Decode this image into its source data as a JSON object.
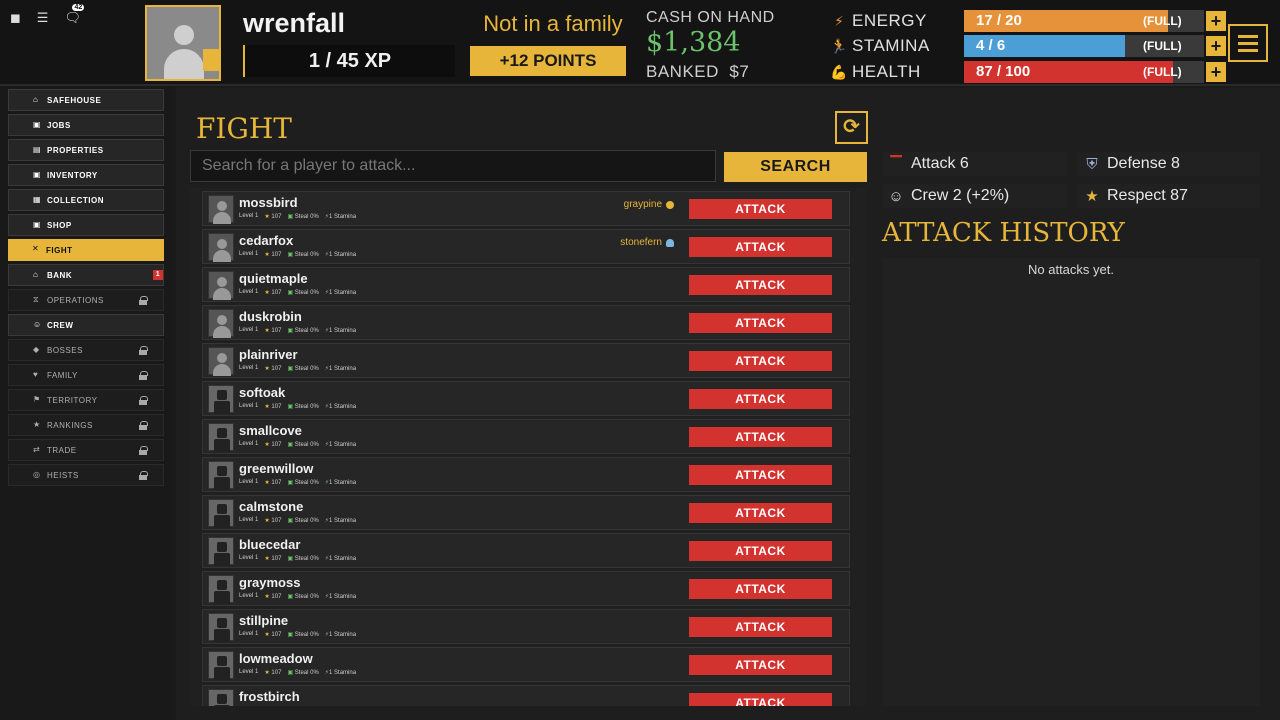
{
  "header": {
    "chat_badge": "42",
    "username": "wrenfall",
    "xp": "1 / 45 XP",
    "family_status": "Not in a family",
    "points_button": "+12 POINTS",
    "cash_label": "CASH ON HAND",
    "cash_value": "$1,384",
    "banked_label": "BANKED",
    "banked_value": "$7",
    "stats": [
      {
        "name": "ENERGY",
        "value": "17 / 20",
        "status": "(FULL)",
        "fill": 0.85,
        "color": "#e6923a",
        "icon": "lightning-icon"
      },
      {
        "name": "STAMINA",
        "value": "4 / 6",
        "status": "(FULL)",
        "fill": 0.67,
        "color": "#4c9ed6",
        "icon": "runner-icon"
      },
      {
        "name": "HEALTH",
        "value": "87 / 100",
        "status": "(FULL)",
        "fill": 0.87,
        "color": "#d2332f",
        "icon": "muscle-icon"
      }
    ]
  },
  "sidebar": {
    "items": [
      {
        "label": "SAFEHOUSE",
        "state": "normal",
        "icon": "house-icon"
      },
      {
        "label": "JOBS",
        "state": "normal",
        "icon": "briefcase-icon"
      },
      {
        "label": "PROPERTIES",
        "state": "normal",
        "icon": "building-icon"
      },
      {
        "label": "INVENTORY",
        "state": "normal",
        "icon": "box-icon"
      },
      {
        "label": "COLLECTION",
        "state": "normal",
        "icon": "grid-icon"
      },
      {
        "label": "SHOP",
        "state": "normal",
        "icon": "shop-icon"
      },
      {
        "label": "FIGHT",
        "state": "active",
        "icon": "crossed-swords-icon"
      },
      {
        "label": "BANK",
        "state": "normal",
        "icon": "bank-icon",
        "badge": "1"
      },
      {
        "label": "OPERATIONS",
        "state": "locked",
        "icon": "hourglass-icon"
      },
      {
        "label": "CREW",
        "state": "normal",
        "icon": "crew-icon"
      },
      {
        "label": "BOSSES",
        "state": "locked",
        "icon": "boss-icon"
      },
      {
        "label": "FAMILY",
        "state": "locked",
        "icon": "family-icon"
      },
      {
        "label": "TERRITORY",
        "state": "locked",
        "icon": "flag-icon"
      },
      {
        "label": "RANKINGS",
        "state": "locked",
        "icon": "trophy-icon"
      },
      {
        "label": "TRADE",
        "state": "locked",
        "icon": "trade-icon"
      },
      {
        "label": "HEISTS",
        "state": "locked",
        "icon": "heist-icon"
      }
    ]
  },
  "fight": {
    "title": "FIGHT",
    "search_placeholder": "Search for a player to attack...",
    "search_button": "SEARCH",
    "attack_label": "ATTACK",
    "players": [
      {
        "name": "mossbird",
        "level": "Level 1",
        "respect": "107",
        "steal": "Steal 0%",
        "stamina": "1 Stamina",
        "family": "graypine",
        "avatar": "default"
      },
      {
        "name": "cedarfox",
        "level": "Level 1",
        "respect": "107",
        "steal": "Steal 0%",
        "stamina": "1 Stamina",
        "family": "stonefern",
        "avatar": "default"
      },
      {
        "name": "quietmaple",
        "level": "Level 1",
        "respect": "107",
        "steal": "Steal 0%",
        "stamina": "1 Stamina",
        "family": "",
        "avatar": "default"
      },
      {
        "name": "duskrobin",
        "level": "Level 1",
        "respect": "107",
        "steal": "Steal 0%",
        "stamina": "1 Stamina",
        "family": "",
        "avatar": "default"
      },
      {
        "name": "plainriver",
        "level": "Level 1",
        "respect": "107",
        "steal": "Steal 0%",
        "stamina": "1 Stamina",
        "family": "",
        "avatar": "default"
      },
      {
        "name": "softoak",
        "level": "Level 1",
        "respect": "107",
        "steal": "Steal 0%",
        "stamina": "1 Stamina",
        "family": "",
        "avatar": "dark"
      },
      {
        "name": "smallcove",
        "level": "Level 1",
        "respect": "107",
        "steal": "Steal 0%",
        "stamina": "1 Stamina",
        "family": "",
        "avatar": "dark"
      },
      {
        "name": "greenwillow",
        "level": "Level 1",
        "respect": "107",
        "steal": "Steal 0%",
        "stamina": "1 Stamina",
        "family": "",
        "avatar": "dark"
      },
      {
        "name": "calmstone",
        "level": "Level 1",
        "respect": "107",
        "steal": "Steal 0%",
        "stamina": "1 Stamina",
        "family": "",
        "avatar": "dark"
      },
      {
        "name": "bluecedar",
        "level": "Level 1",
        "respect": "107",
        "steal": "Steal 0%",
        "stamina": "1 Stamina",
        "family": "",
        "avatar": "dark"
      },
      {
        "name": "graymoss",
        "level": "Level 1",
        "respect": "107",
        "steal": "Steal 0%",
        "stamina": "1 Stamina",
        "family": "",
        "avatar": "dark"
      },
      {
        "name": "stillpine",
        "level": "Level 1",
        "respect": "107",
        "steal": "Steal 0%",
        "stamina": "1 Stamina",
        "family": "",
        "avatar": "dark"
      },
      {
        "name": "lowmeadow",
        "level": "Level 1",
        "respect": "107",
        "steal": "Steal 0%",
        "stamina": "1 Stamina",
        "family": "",
        "avatar": "dark"
      },
      {
        "name": "frostbirch",
        "level": "Level 1",
        "respect": "107",
        "steal": "Steal 0%",
        "stamina": "1 Stamina",
        "family": "",
        "avatar": "dark"
      }
    ]
  },
  "right": {
    "stats": [
      {
        "label": "Attack 6",
        "icon": "gun-icon",
        "color": "#d2332f"
      },
      {
        "label": "Defense 8",
        "icon": "shield-icon",
        "color": "#9ab0d8"
      },
      {
        "label": "Crew 2 (+2%)",
        "icon": "crew-icon",
        "color": "#e0e0e0"
      },
      {
        "label": "Respect 87",
        "icon": "star-icon",
        "color": "#e6b53a"
      }
    ],
    "history_title": "ATTACK HISTORY",
    "history_empty": "No attacks yet."
  }
}
